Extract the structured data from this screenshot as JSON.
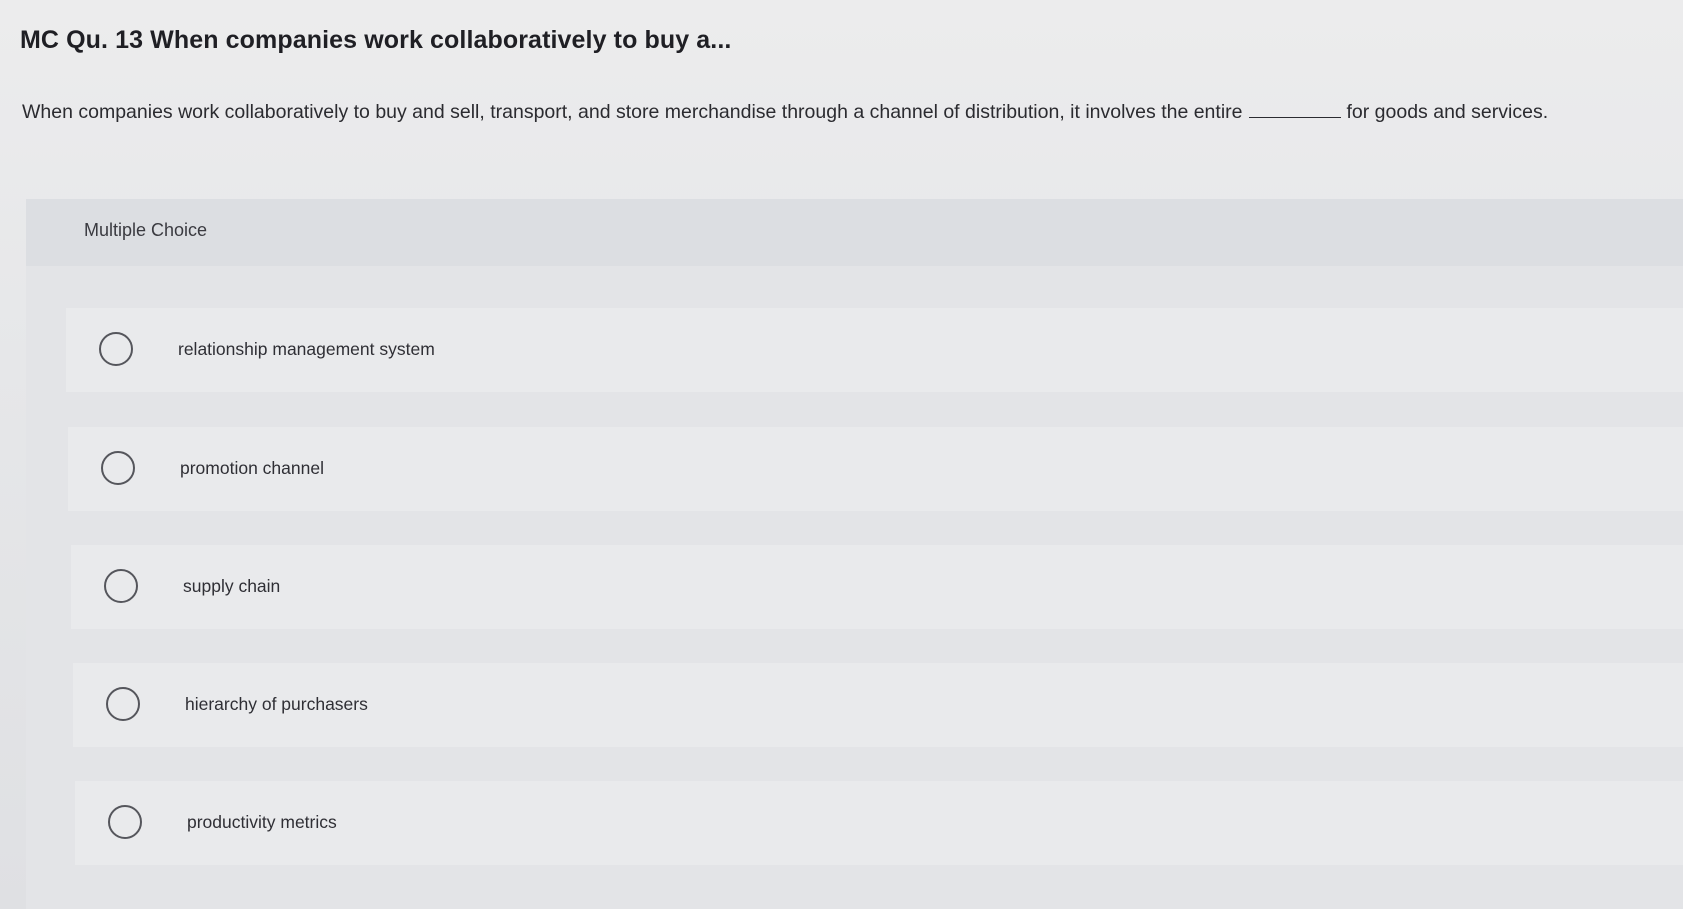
{
  "question": {
    "title": "MC Qu. 13 When companies work collaboratively to buy a...",
    "stem_before_blank": "When companies work collaboratively to buy and sell, transport, and store merchandise through a channel of distribution, it involves the entire",
    "stem_after_blank": "for goods and services."
  },
  "card": {
    "header_label": "Multiple Choice"
  },
  "options": [
    {
      "label": "relationship management system",
      "selected": false
    },
    {
      "label": "promotion channel",
      "selected": false
    },
    {
      "label": "supply chain",
      "selected": false
    },
    {
      "label": "hierarchy of purchasers",
      "selected": false
    },
    {
      "label": "productivity metrics",
      "selected": false
    }
  ],
  "colors": {
    "background": "#e6e7e9",
    "card": "#e3e4e7",
    "option_row": "#e9eaec",
    "text": "#2a2a2e",
    "radio_border": "#55565c"
  }
}
